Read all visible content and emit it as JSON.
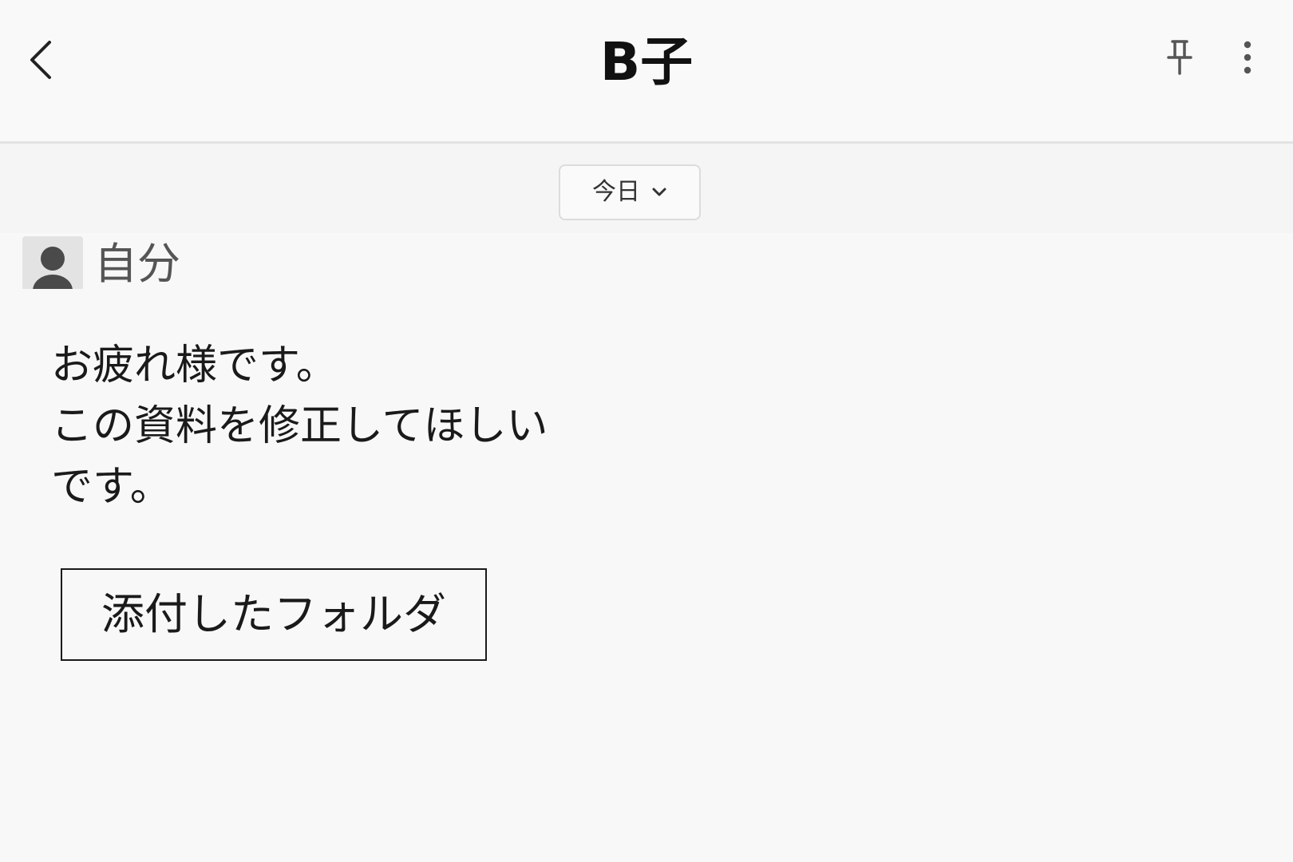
{
  "header": {
    "title": "B子",
    "back_icon": "chevron-left-icon",
    "pin_icon": "pin-icon",
    "more_icon": "more-vertical-icon"
  },
  "date_filter": {
    "label": "今日",
    "icon": "chevron-down-icon"
  },
  "message": {
    "sender": "自分",
    "avatar_icon": "user-avatar-icon",
    "lines": [
      "お疲れ様です。",
      "この資料を修正してほしい",
      "です。"
    ],
    "attachment_label": "添付したフォルダ"
  },
  "colors": {
    "background": "#f8f8f8",
    "header_background": "#f9f9f9",
    "divider": "#e3e3e3",
    "text": "#1a1a1a",
    "sender_text": "#555555"
  }
}
